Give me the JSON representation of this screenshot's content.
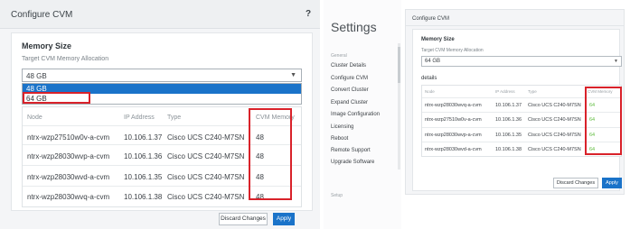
{
  "left": {
    "title": "Configure CVM",
    "help": "?",
    "memory_size": "Memory Size",
    "alloc_label": "Target CVM Memory Allocation",
    "select_value": "48 GB",
    "options": [
      "48 GB",
      "64 GB"
    ],
    "table": {
      "headers": [
        "Node",
        "IP Address",
        "Type",
        "CVM Memory"
      ],
      "rows": [
        [
          "ntrx-wzp27510w0v-a-cvm",
          "10.106.1.37",
          "Cisco UCS C240-M7SN",
          "48"
        ],
        [
          "ntrx-wzp28030wvp-a-cvm",
          "10.106.1.36",
          "Cisco UCS C240-M7SN",
          "48"
        ],
        [
          "ntrx-wzp28030wvd-a-cvm",
          "10.106.1.35",
          "Cisco UCS C240-M7SN",
          "48"
        ],
        [
          "ntrx-wzp28030wvq-a-cvm",
          "10.106.1.38",
          "Cisco UCS C240-M7SN",
          "48"
        ]
      ]
    },
    "discard_label": "Discard Changes",
    "apply_label": "Apply",
    "highlight_color": "#d9222a",
    "accent_color": "#1a73c9"
  },
  "right": {
    "settings_title": "Settings",
    "section_general": "General",
    "nav": [
      "Cluster Details",
      "Configure CVM",
      "Convert Cluster",
      "Expand Cluster",
      "Image Configuration",
      "Licensing",
      "Reboot",
      "Remote Support",
      "Upgrade Software"
    ],
    "section_setup": "Setup",
    "title": "Configure CVM",
    "memory_size": "Memory Size",
    "alloc_label": "Target CVM Memory Allocation",
    "select_value": "64 GB",
    "details_label": "details",
    "table": {
      "headers": [
        "Node",
        "IP Address",
        "Type",
        "CVM Memory"
      ],
      "rows": [
        [
          "ntrx-wzp28030wvq-a-cvm",
          "10.106.1.37",
          "Cisco UCS C240-M7SN",
          "64"
        ],
        [
          "ntrx-wzp27510w0v-a-cvm",
          "10.106.1.36",
          "Cisco UCS C240-M7SN",
          "64"
        ],
        [
          "ntrx-wzp28030wvp-a-cvm",
          "10.106.1.35",
          "Cisco UCS C240-M7SN",
          "64"
        ],
        [
          "ntrx-wzp28030wvd-a-cvm",
          "10.106.1.38",
          "Cisco UCS C240-M7SN",
          "64"
        ]
      ]
    },
    "discard_label": "Discard Changes",
    "apply_label": "Apply",
    "value_color": "#5dbb3c"
  }
}
